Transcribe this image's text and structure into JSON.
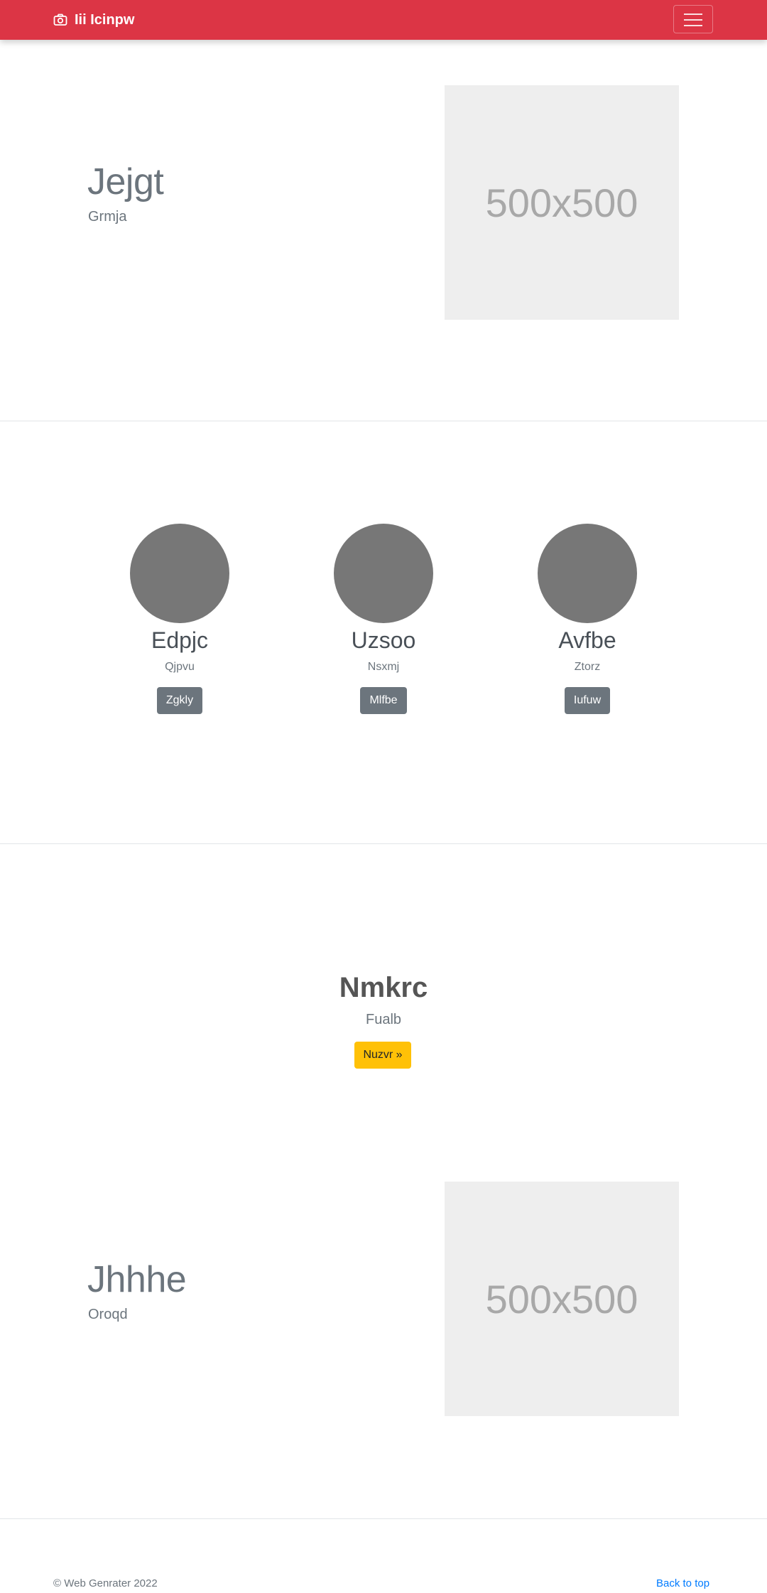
{
  "navbar": {
    "brand_icon": "camera-icon",
    "brand": "Iii Icinpw",
    "toggler_icon": "hamburger-icon",
    "color": "#dc3545"
  },
  "feature1": {
    "title": "Jejgt",
    "subtitle": "Grmja",
    "image_label": "500x500"
  },
  "columns": [
    {
      "name": "Edpjc",
      "subtitle": "Qjpvu",
      "button": "Zgkly"
    },
    {
      "name": "Uzsoo",
      "subtitle": "Nsxmj",
      "button": "Mlfbe"
    },
    {
      "name": "Avfbe",
      "subtitle": "Ztorz",
      "button": "Iufuw"
    }
  ],
  "cta": {
    "title": "Nmkrc",
    "subtitle": "Fualb",
    "button": "Nuzvr »",
    "button_color": "#ffc107"
  },
  "feature2": {
    "title": "Jhhhe",
    "subtitle": "Oroqd",
    "image_label": "500x500"
  },
  "footer": {
    "copyright": "© Web Genrater 2022",
    "back_to_top": "Back to top",
    "link_color": "#007bff"
  }
}
